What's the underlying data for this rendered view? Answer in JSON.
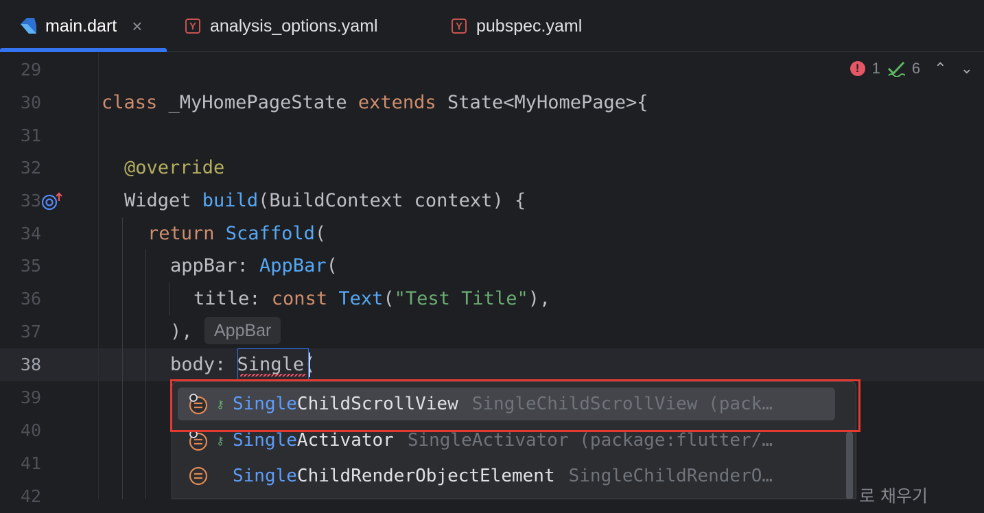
{
  "tabs": [
    {
      "label": "main.dart",
      "icon": "dart-file-icon",
      "active": true,
      "closable": true
    },
    {
      "label": "analysis_options.yaml",
      "icon": "yaml-file-icon",
      "active": false
    },
    {
      "label": "pubspec.yaml",
      "icon": "yaml-file-icon",
      "active": false
    }
  ],
  "inspections": {
    "errors": "1",
    "warnings": "6"
  },
  "gutter": [
    "29",
    "30",
    "31",
    "32",
    "33",
    "34",
    "35",
    "36",
    "37",
    "38",
    "39",
    "40",
    "41",
    "42"
  ],
  "code": {
    "l30": {
      "kw_class": "class",
      "name": " _MyHomePageState ",
      "kw_extends": "extends",
      "rest": " State<MyHomePage>{"
    },
    "l32": {
      "ann": "@override"
    },
    "l33": {
      "type": "Widget ",
      "fn": "build",
      "rest": "(BuildContext context) {"
    },
    "l34": {
      "kw": "return ",
      "cls": "Scaffold",
      "rest": "("
    },
    "l35": {
      "prop": "appBar: ",
      "cls": "AppBar",
      "rest": "("
    },
    "l36": {
      "prop": "title: ",
      "kw": "const ",
      "cls": "Text",
      "open": "(",
      "str": "\"Test Title\"",
      "rest": "),"
    },
    "l37": {
      "text": "),"
    },
    "l38": {
      "prop": "body: ",
      "typed": "Single",
      "rest": "("
    }
  },
  "hint_label": "AppBar",
  "completion": [
    {
      "match": "Single",
      "rest": "ChildScrollView",
      "detail": "SingleChildScrollView (pack…",
      "lock": true,
      "selected": true
    },
    {
      "match": "Single",
      "rest": "Activator",
      "detail": "SingleActivator (package:flutter/…",
      "lock": true,
      "selected": false
    },
    {
      "match": "Single",
      "rest": "ChildRenderObjectElement",
      "detail": "SingleChildRenderO…",
      "lock": false,
      "selected": false
    }
  ],
  "background_text": "로 채우기",
  "colors": {
    "accent": "#3574f0",
    "highlight": "#e53a2f",
    "keyword": "#cf8e6d",
    "function": "#56a8f5",
    "string": "#6aab73"
  }
}
